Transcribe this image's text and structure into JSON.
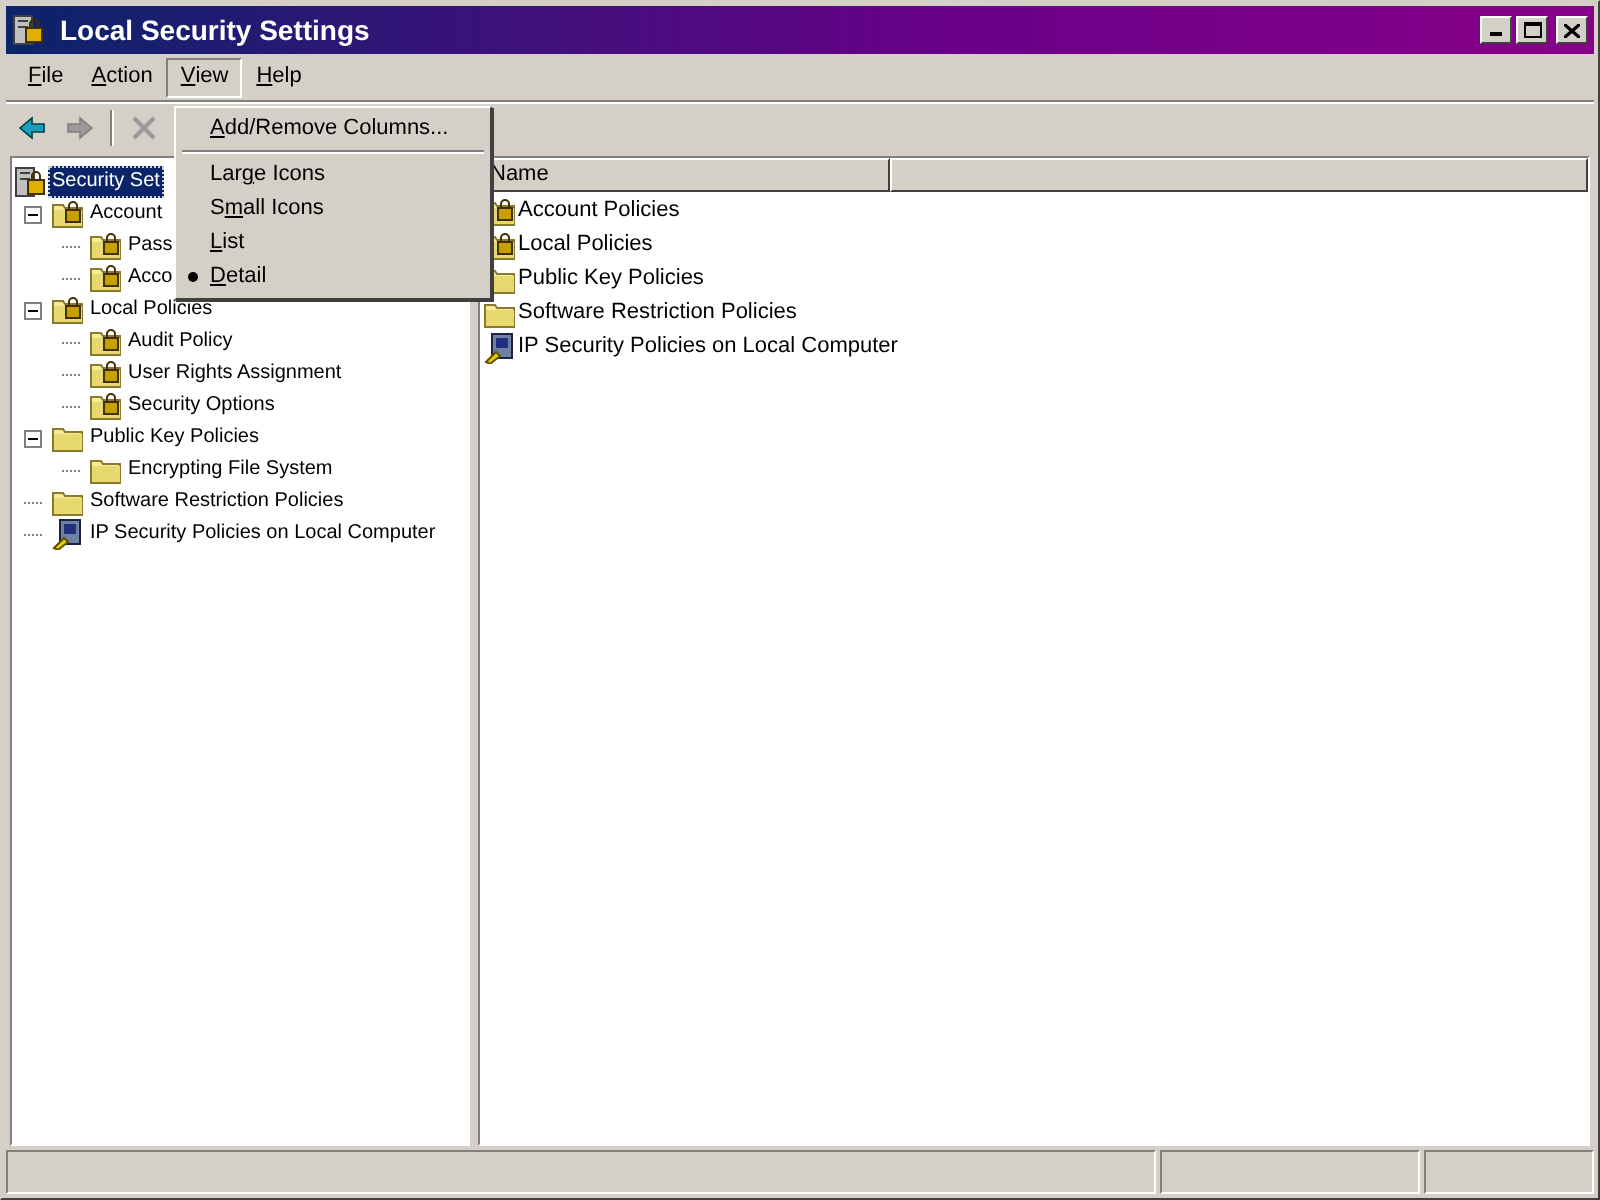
{
  "window": {
    "title": "Local Security Settings"
  },
  "menu_bar": [
    {
      "key": "F",
      "after": "ile",
      "open": false
    },
    {
      "key": "A",
      "after": "ction",
      "open": false
    },
    {
      "key": "V",
      "after": "iew",
      "open": true
    },
    {
      "key": "H",
      "after": "elp",
      "open": false
    }
  ],
  "toolbar": [
    {
      "kind": "back",
      "disabled": false
    },
    {
      "kind": "forward",
      "disabled": true
    },
    {
      "kind": "separator"
    },
    {
      "kind": "delete",
      "disabled": true
    }
  ],
  "view_menu": [
    {
      "kind": "item",
      "key": "A",
      "after": "dd/Remove Columns...",
      "checked": false
    },
    {
      "kind": "separator"
    },
    {
      "kind": "item",
      "before": "Lar",
      "key": "g",
      "after": "e Icons",
      "checked": false
    },
    {
      "kind": "item",
      "before": "S",
      "key": "m",
      "after": "all Icons",
      "checked": false
    },
    {
      "kind": "item",
      "key": "L",
      "after": "ist",
      "checked": false
    },
    {
      "kind": "item",
      "key": "D",
      "after": "etail",
      "checked": true
    }
  ],
  "tree": [
    {
      "label": "Security Set",
      "kind": "root",
      "selected": true,
      "children": [
        {
          "label": "Account",
          "kind": "locked",
          "selected": false,
          "expanded": true,
          "children": [
            {
              "label": "Pass",
              "kind": "locked",
              "selected": false
            },
            {
              "label": "Acco",
              "kind": "locked",
              "selected": false
            }
          ]
        },
        {
          "label": "Local Policies",
          "kind": "locked",
          "selected": false,
          "expanded": true,
          "children": [
            {
              "label": "Audit Policy",
              "kind": "locked",
              "selected": false
            },
            {
              "label": "User Rights Assignment",
              "kind": "locked",
              "selected": false
            },
            {
              "label": "Security Options",
              "kind": "locked",
              "selected": false
            }
          ]
        },
        {
          "label": "Public Key Policies",
          "kind": "folder",
          "selected": false,
          "expanded": true,
          "children": [
            {
              "label": "Encrypting File System",
              "kind": "folder",
              "selected": false
            }
          ]
        },
        {
          "label": "Software Restriction Policies",
          "kind": "folder",
          "selected": false
        },
        {
          "label": "IP Security Policies on Local Computer",
          "kind": "computer",
          "selected": false
        }
      ]
    }
  ],
  "list": {
    "columns": [
      "Name"
    ],
    "rows": [
      {
        "label": "Account Policies",
        "kind": "locked"
      },
      {
        "label": "Local Policies",
        "kind": "locked"
      },
      {
        "label": "Public Key Policies",
        "kind": "folder"
      },
      {
        "label": "Software Restriction Policies",
        "kind": "folder"
      },
      {
        "label": "IP Security Policies on Local Computer",
        "kind": "computer"
      }
    ]
  }
}
